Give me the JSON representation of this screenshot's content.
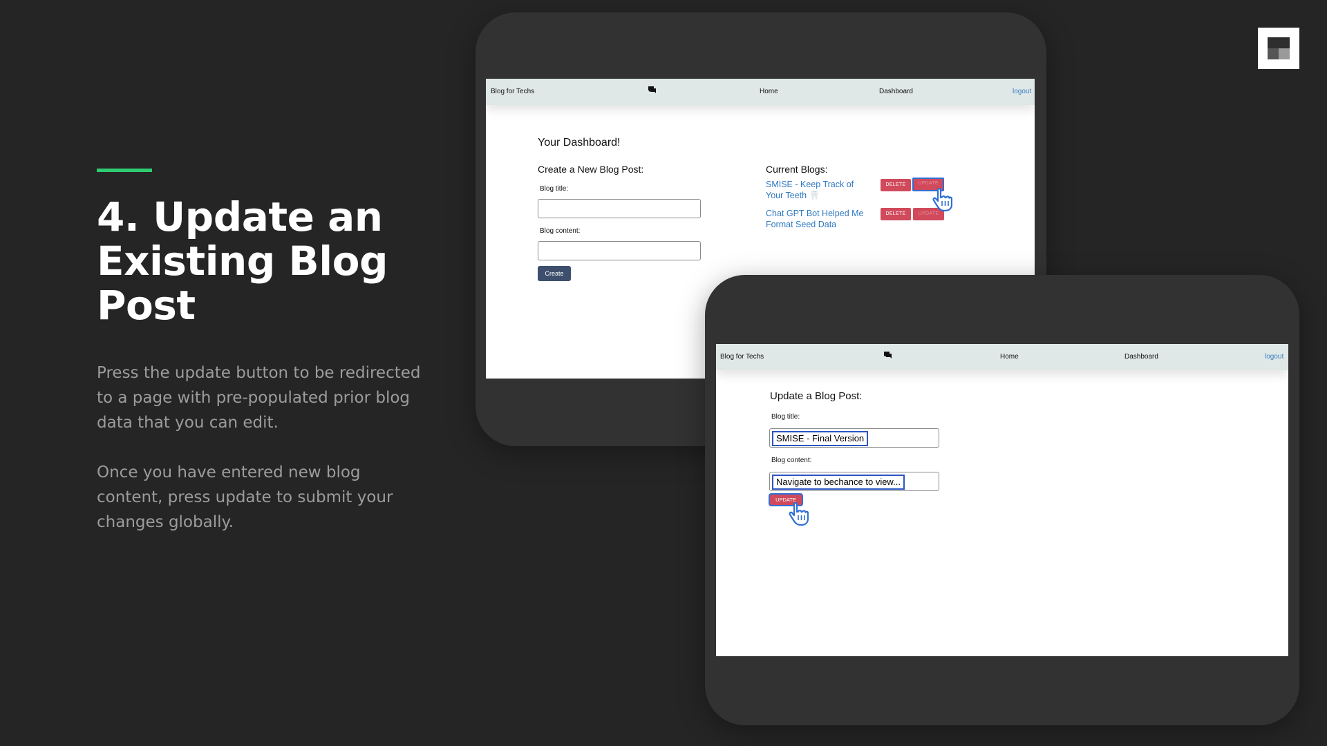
{
  "slide": {
    "title": "4. Update an Existing Blog Post",
    "paragraph1": "Press the update button to be redirected to a page with pre-populated prior blog data that you can edit.",
    "paragraph2": "Once you have entered new blog content, press update to submit your changes globally.",
    "accent_color": "#2ecc71"
  },
  "navbar": {
    "brand": "Blog for Techs",
    "icon": "chat-icon",
    "home": "Home",
    "dashboard": "Dashboard",
    "logout": "logout"
  },
  "dashboard_screen": {
    "heading": "Your Dashboard!",
    "create_heading": "Create a New Blog Post:",
    "title_label": "Blog title:",
    "content_label": "Blog content:",
    "create_button": "Create",
    "current_heading": "Current Blogs:",
    "blogs": [
      {
        "title_line1": "SMISE - Keep Track of",
        "title_line2": "Your Teeth",
        "emoji": "🦷",
        "delete_label": "DELETE",
        "update_label": "UPDATE"
      },
      {
        "title_line1": "Chat GPT Bot Helped Me",
        "title_line2": "Format Seed Data",
        "delete_label": "DELETE",
        "update_label": "UPDATE"
      }
    ]
  },
  "update_screen": {
    "heading": "Update a Blog Post:",
    "title_label": "Blog title:",
    "title_value": "SMISE - Final Version",
    "content_label": "Blog content:",
    "content_value": "Navigate to bechance to view...",
    "update_button": "UPDATE"
  },
  "colors": {
    "background": "#252525",
    "device": "#323232",
    "navbar": "#dfe7e7",
    "link": "#2e79c0",
    "danger": "#d04a5c",
    "primary": "#3d4f6d"
  }
}
